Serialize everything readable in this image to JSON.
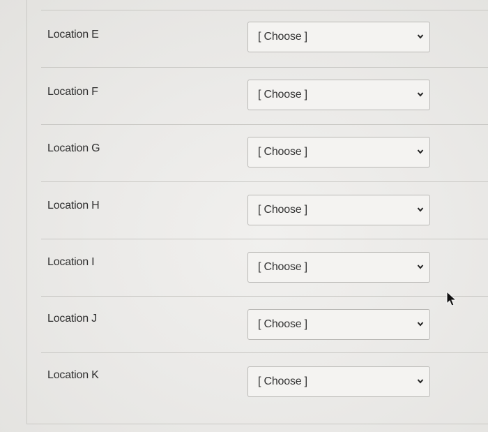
{
  "locations": [
    {
      "label": "Location E",
      "selected": "[ Choose ]"
    },
    {
      "label": "Location F",
      "selected": "[ Choose ]"
    },
    {
      "label": "Location G",
      "selected": "[ Choose ]"
    },
    {
      "label": "Location H",
      "selected": "[ Choose ]"
    },
    {
      "label": "Location I",
      "selected": "[ Choose ]"
    },
    {
      "label": "Location J",
      "selected": "[ Choose ]"
    },
    {
      "label": "Location K",
      "selected": "[ Choose ]"
    }
  ],
  "icons": {
    "dropdown": "chevron-down-icon",
    "pointer": "mouse-pointer-icon"
  },
  "colors": {
    "text": "#2f2f2f",
    "border": "#b9b8b5",
    "background": "#ebeae8"
  }
}
